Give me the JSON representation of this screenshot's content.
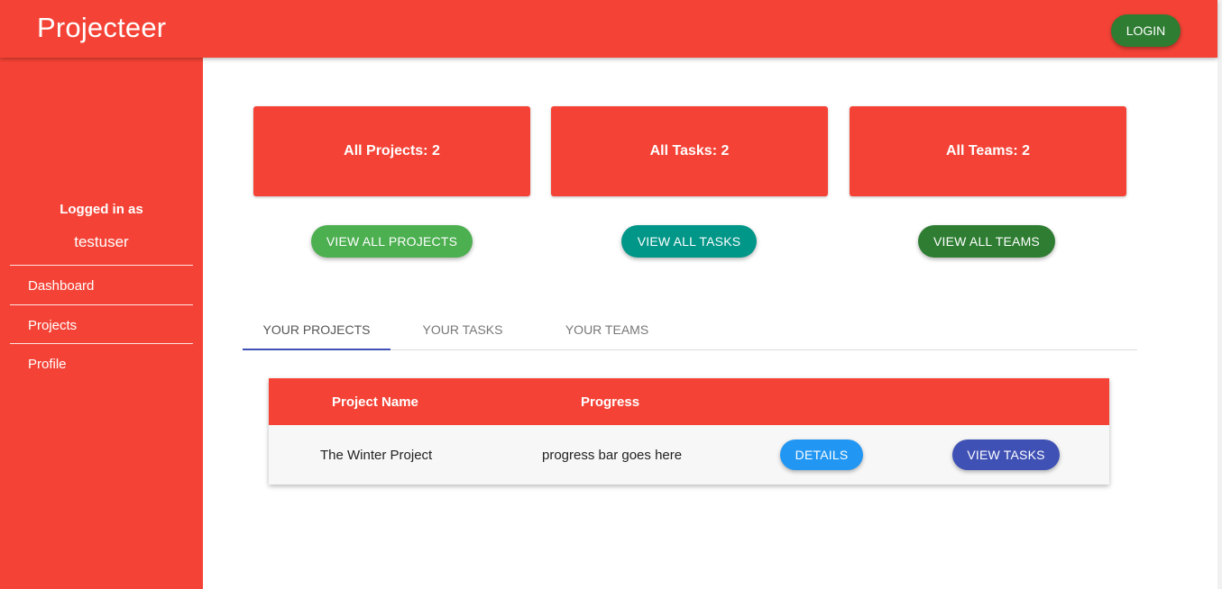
{
  "header": {
    "brand": "Projecteer",
    "login_label": "LOGIN"
  },
  "sidebar": {
    "logged_in_label": "Logged in as",
    "username": "testuser",
    "items": [
      {
        "label": "Dashboard"
      },
      {
        "label": "Projects"
      },
      {
        "label": "Profile"
      }
    ]
  },
  "stats": [
    {
      "label": "All Projects: 2",
      "button": "VIEW ALL PROJECTS",
      "button_color": "#4caf50"
    },
    {
      "label": "All Tasks: 2",
      "button": "VIEW ALL TASKS",
      "button_color": "#009688"
    },
    {
      "label": "All Teams: 2",
      "button": "VIEW ALL TEAMS",
      "button_color": "#2e7d32"
    }
  ],
  "tabs": [
    {
      "label": "YOUR PROJECTS",
      "active": true
    },
    {
      "label": "YOUR TASKS",
      "active": false
    },
    {
      "label": "YOUR TEAMS",
      "active": false
    }
  ],
  "table": {
    "headers": [
      "Project Name",
      "Progress"
    ],
    "rows": [
      {
        "name": "The Winter Project",
        "progress": "progress bar goes here",
        "details_label": "DETAILS",
        "view_tasks_label": "VIEW TASKS"
      }
    ]
  },
  "colors": {
    "primary": "#f44336",
    "tab_indicator": "#3f51b5",
    "details_button": "#2196f3",
    "view_tasks_button": "#3f51b5"
  }
}
